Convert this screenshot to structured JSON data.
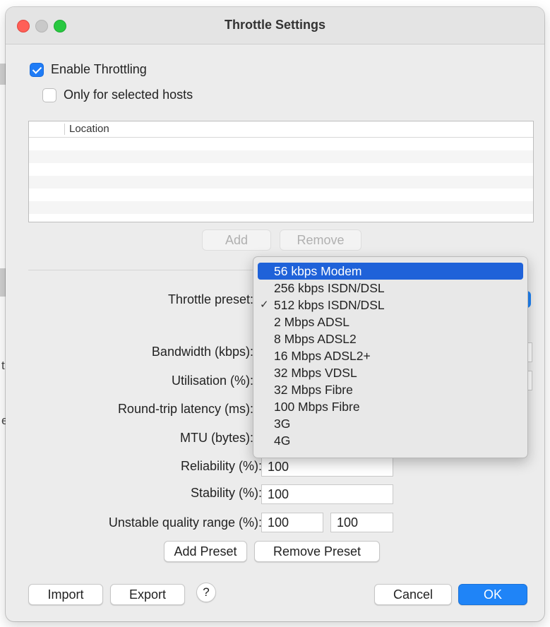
{
  "window": {
    "title": "Throttle Settings"
  },
  "enable_throttling": {
    "label": "Enable Throttling",
    "checked": true
  },
  "only_selected_hosts": {
    "label": "Only for selected hosts",
    "checked": false
  },
  "hosts_table": {
    "columns": [
      "",
      "Location"
    ],
    "rows": []
  },
  "host_buttons": {
    "add": "Add",
    "remove": "Remove"
  },
  "preset": {
    "label": "Throttle preset:",
    "selected": "512 kbps ISDN/DSL",
    "highlighted": "56 kbps Modem",
    "options": [
      "56 kbps Modem",
      "256 kbps ISDN/DSL",
      "512 kbps ISDN/DSL",
      "2 Mbps ADSL",
      "8 Mbps ADSL2",
      "16 Mbps ADSL2+",
      "32 Mbps VDSL",
      "32 Mbps Fibre",
      "100 Mbps Fibre",
      "3G",
      "4G"
    ],
    "check_glyph": "✓"
  },
  "params": {
    "bandwidth_label": "Bandwidth (kbps):",
    "utilisation_label": "Utilisation (%):",
    "latency_label": "Round-trip latency (ms):",
    "mtu_label": "MTU (bytes):",
    "reliability_label": "Reliability (%):",
    "reliability_value": "100",
    "stability_label": "Stability (%):",
    "stability_value": "100",
    "unstable_label": "Unstable quality range (%):",
    "unstable_min": "100",
    "unstable_max": "100"
  },
  "preset_buttons": {
    "add": "Add Preset",
    "remove": "Remove Preset"
  },
  "footer": {
    "import": "Import",
    "export": "Export",
    "help": "?",
    "cancel": "Cancel",
    "ok": "OK"
  },
  "background_fragments": [
    "t",
    "e"
  ],
  "colors": {
    "accent": "#1f84f7",
    "menu_highlight": "#1f62d9",
    "close": "#ff5f57",
    "zoom": "#28c840"
  }
}
